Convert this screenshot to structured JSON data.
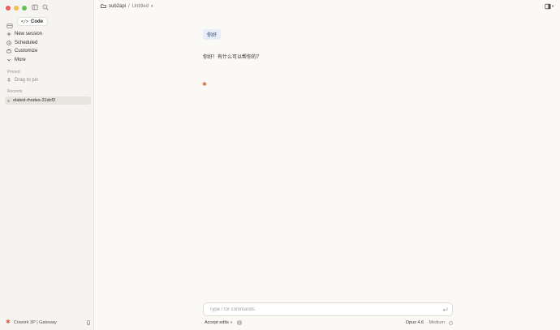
{
  "sidebar": {
    "mode_label": "Code",
    "nav": [
      {
        "label": "New session",
        "icon": "plus-icon"
      },
      {
        "label": "Scheduled",
        "icon": "clock-icon"
      },
      {
        "label": "Customize",
        "icon": "briefcase-icon"
      },
      {
        "label": "More",
        "icon": "chevron-down-icon"
      }
    ],
    "pinned_label": "Pinned",
    "drag_to_pin": "Drag to pin",
    "recents_label": "Recents",
    "recents": [
      {
        "label": "elated-rhodes-31dcf3"
      }
    ],
    "footer_label": "Cowork 3P | Gateway"
  },
  "topbar": {
    "project": "sub2api",
    "separator": "/",
    "session": "Untitled"
  },
  "conversation": {
    "user_message": "你好",
    "assistant_message": "你好！有什么可以帮你的？",
    "thinking_glyph": "✱"
  },
  "composer": {
    "placeholder": "Type / for commands",
    "accept_label": "Accept edits",
    "model": "Opus 4.6",
    "effort": "· Medium"
  },
  "colors": {
    "accent": "#d9653e",
    "user_bubble": "#e8eef7",
    "background": "#faf9f6",
    "sidebar": "#f5f4f0"
  }
}
